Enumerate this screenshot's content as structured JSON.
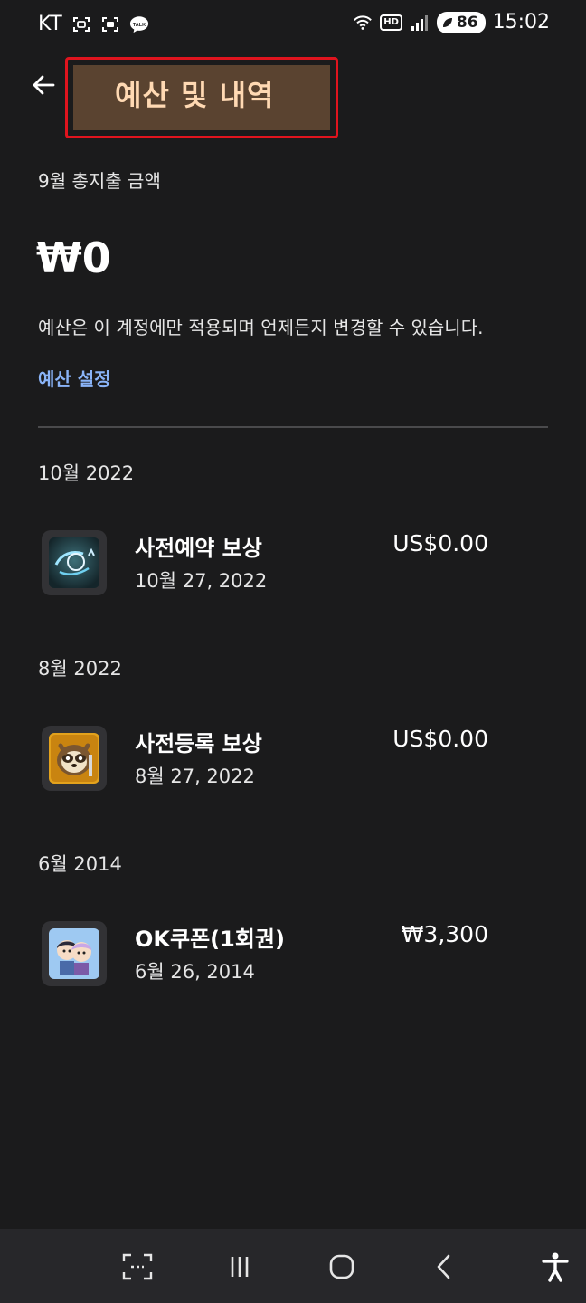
{
  "status_bar": {
    "carrier": "KT",
    "battery": "86",
    "network_badge": "HD",
    "time": "15:02",
    "icons": [
      "screen-record-icon",
      "screenshot-icon",
      "kakaotalk-icon",
      "wifi-icon",
      "hd-icon",
      "signal-icon",
      "battery-icon"
    ]
  },
  "header": {
    "title": "예산 및 내역",
    "back_icon": "arrow-left-icon"
  },
  "summary": {
    "label": "9월 총지출 금액",
    "amount": "₩0",
    "note": "예산은 이 계정에만 적용되며 언제든지 변경할 수 있습니다.",
    "budget_link": "예산 설정"
  },
  "history": [
    {
      "month": "10월 2022",
      "items": [
        {
          "name": "사전예약 보상",
          "date": "10월 27, 2022",
          "amount": "US$0.00",
          "icon": "game-app-icon-cheonsangbi"
        }
      ]
    },
    {
      "month": "8월 2022",
      "items": [
        {
          "name": "사전등록 보상",
          "date": "8월 27, 2022",
          "amount": "US$0.00",
          "icon": "game-app-icon-raccoon"
        }
      ]
    },
    {
      "month": "6월 2014",
      "items": [
        {
          "name": "OK쿠폰(1회권)",
          "date": "6월 26, 2014",
          "amount": "₩3,300",
          "icon": "game-app-icon-characters"
        }
      ]
    }
  ],
  "colors": {
    "background": "#1b1b1c",
    "link": "#8ab4f8",
    "highlight_border": "#e0141e",
    "highlight_fill": "#5a4330",
    "title_text": "#ffd9b3"
  },
  "nav_bar": {
    "icons": [
      "capture-icon",
      "recent-apps-icon",
      "home-icon",
      "back-icon",
      "accessibility-icon"
    ]
  }
}
